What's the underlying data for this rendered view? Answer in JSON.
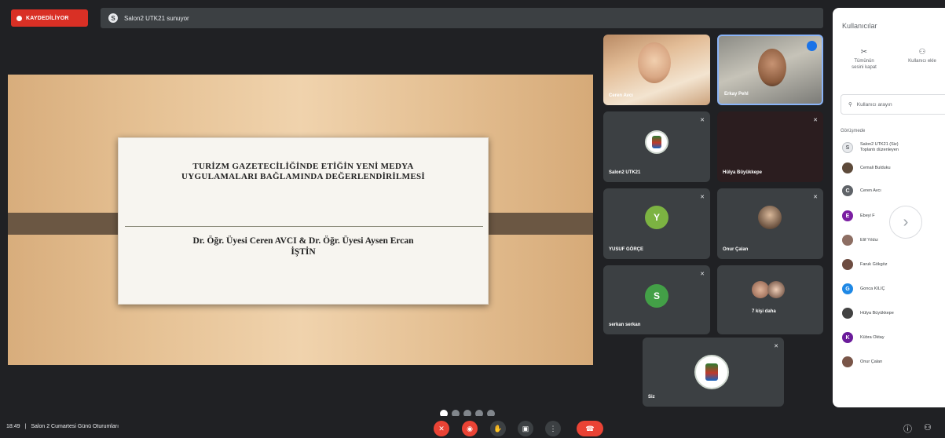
{
  "top": {
    "recording_label": "KAYDEDİLİYOR",
    "presenting_text": "Salon2 UTK21 sunuyor"
  },
  "slide": {
    "title_line1": "TURİZM GAZETECİLİĞİNDE ETİĞİN YENİ MEDYA",
    "title_line2": "UYGULAMALARI BAĞLAMINDA DEĞERLENDİRİLMESİ",
    "authors_line1": "Dr. Öğr. Üyesi Ceren AVCI & Dr. Öğr. Üyesi Aysen Ercan",
    "authors_line2": "İŞTİN"
  },
  "tiles": [
    {
      "name": "Ceren Avcı"
    },
    {
      "name": "Erkay Pehl"
    },
    {
      "name": "Salon2 UTK21"
    },
    {
      "name": "Hülya Büyükkepe"
    },
    {
      "name": "YUSUF GÖRÇE",
      "initial": "Y"
    },
    {
      "name": "Onur Çalan"
    },
    {
      "name": "serkan serkan",
      "initial": "S"
    },
    {
      "name": "7 kişi daha"
    },
    {
      "name": "Siz"
    }
  ],
  "panel": {
    "title": "Kullanıcılar",
    "action1": "Tümünün sesini kapat",
    "action2": "Kullanıcı ekle",
    "search_placeholder": "Kullanıcı arayın",
    "section": "Görüşmede",
    "users": [
      {
        "name": "Salon2 UTK21 (Siz)",
        "sub": "Toplantı düzenleyen",
        "initial": "",
        "color": "#e8eaed"
      },
      {
        "name": "Cemali Bulduku",
        "initial": "",
        "color": "#5d4a3a"
      },
      {
        "name": "Ceren Avcı",
        "initial": "C",
        "color": "#5f6368"
      },
      {
        "name": "Ebeyi F",
        "initial": "E",
        "color": "#7b1fa2"
      },
      {
        "name": "Elif Yıldız",
        "initial": "",
        "color": "#8d6e63"
      },
      {
        "name": "Faruk Gökgöz",
        "initial": "",
        "color": "#6d4c41"
      },
      {
        "name": "Gonca KILIÇ",
        "initial": "G",
        "color": "#1e88e5"
      },
      {
        "name": "Hülya Büyükkepe",
        "initial": "",
        "color": "#424242"
      },
      {
        "name": "Kübra Oktay",
        "initial": "K",
        "color": "#6a1b9a"
      },
      {
        "name": "Onur Çalan",
        "initial": "",
        "color": "#795548"
      }
    ]
  },
  "bottom": {
    "time": "18:49",
    "separator": "|",
    "meeting_name": "Salon 2 Cumartesi Günü Oturumları"
  },
  "colors": {
    "accent_red": "#ea4335",
    "accent_blue": "#1a73e8",
    "avatar_green": "#43a047"
  }
}
